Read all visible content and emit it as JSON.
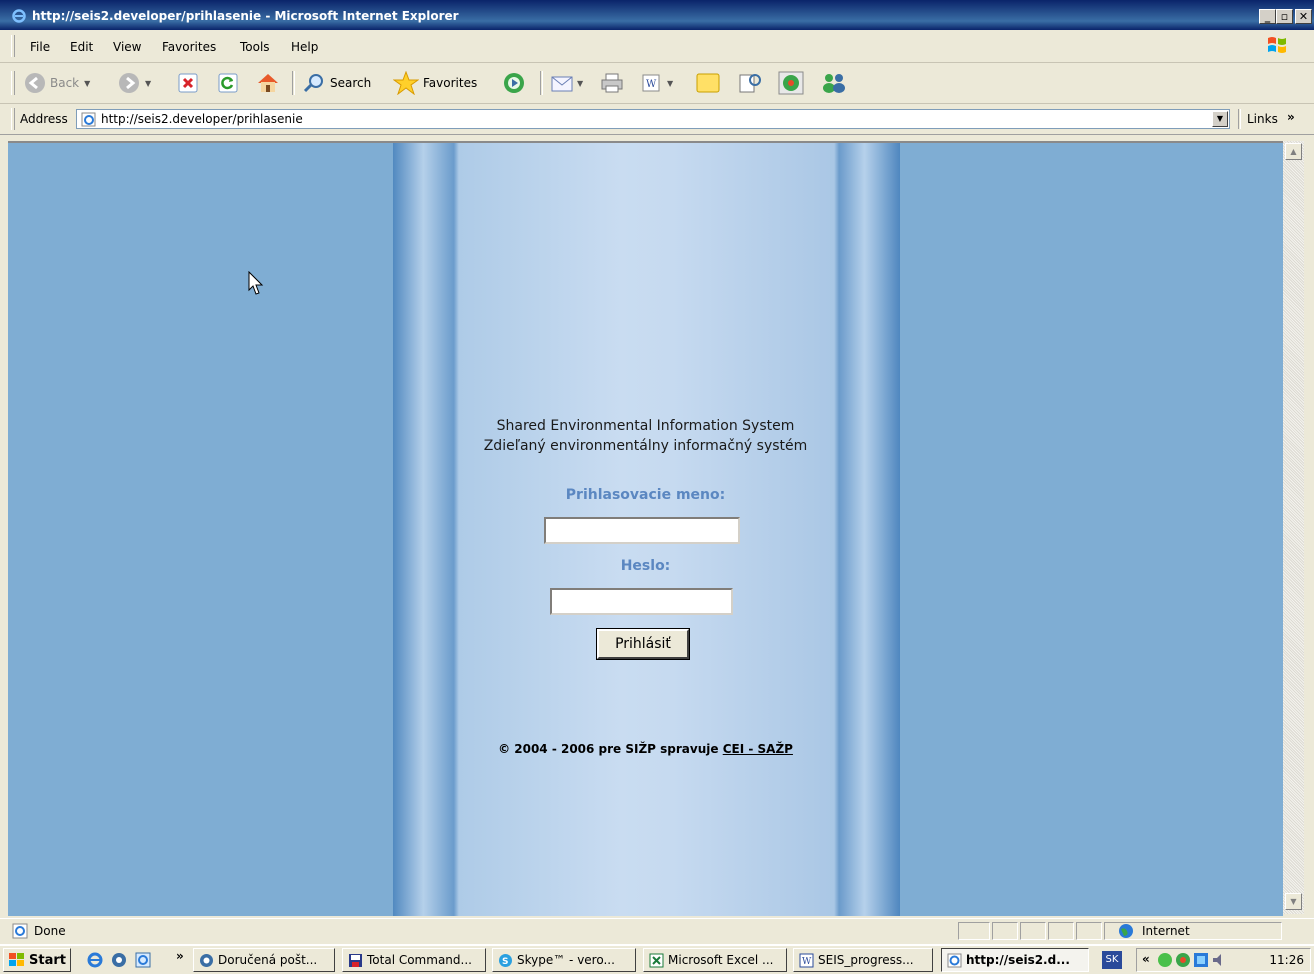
{
  "window": {
    "title": "http://seis2.developer/prihlasenie - Microsoft Internet Explorer"
  },
  "menu": {
    "items": [
      "File",
      "Edit",
      "View",
      "Favorites",
      "Tools",
      "Help"
    ]
  },
  "toolbar": {
    "back": "Back",
    "search": "Search",
    "favorites": "Favorites"
  },
  "address": {
    "label": "Address",
    "url": "http://seis2.developer/prihlasenie",
    "links": "Links",
    "links_chevron": "»"
  },
  "page": {
    "title_en": "Shared Environmental Information System",
    "title_sk": "Zdieľaný environmentálny informačný systém",
    "username_label": "Prihlasovacie meno:",
    "username_value": "",
    "password_label": "Heslo:",
    "password_value": "",
    "login_button": "Prihlásiť",
    "footer_text": "© 2004 - 2006 pre SIŽP spravuje ",
    "footer_link": "CEI - SAŽP"
  },
  "status": {
    "text": "Done",
    "zone": "Internet"
  },
  "taskbar": {
    "start": "Start",
    "chevron": "»",
    "tasks": [
      "Doručená pošt...",
      "Total Command...",
      "Skype™ - vero...",
      "Microsoft Excel ...",
      "SEIS_progress...",
      "http://seis2.d..."
    ],
    "language": "SK",
    "tray_chevron": "«",
    "clock": "11:26"
  },
  "colors": {
    "page_bg": "#7fadd3",
    "label": "#5b87c1",
    "title_bar": "#0a246a"
  }
}
